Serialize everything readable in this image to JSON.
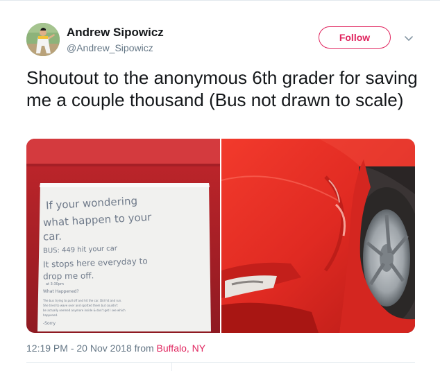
{
  "author": {
    "name": "Andrew Sipowicz",
    "handle": "@Andrew_Sipowicz"
  },
  "header": {
    "follow_label": "Follow",
    "menu_icon": "chevron-down-icon"
  },
  "tweet": {
    "text": "Shoutout to the anonymous 6th grader for saving me a couple thousand (Bus not drawn to scale)",
    "time": "12:19 PM - 20 Nov 2018",
    "from_label": "from",
    "location": "Buffalo, NY"
  },
  "note": {
    "lines": [
      "If your wondering",
      "what happen to your",
      "car.",
      "BUS: 449 hit your car",
      "It stops here everyday to",
      "drop me off.",
      "at 3:30pm",
      "What Happened?",
      "The bus trying to pull off and hit the car. Did hit and run.",
      "She tried to wave over and spotted them but couldn't",
      "be actually seemed anymore inside & don't get I see which",
      "happened.",
      "-Sorry"
    ]
  },
  "colors": {
    "follow_accent": "#e0245e",
    "secondary_text": "#657786",
    "car_red": "#e02a22"
  }
}
